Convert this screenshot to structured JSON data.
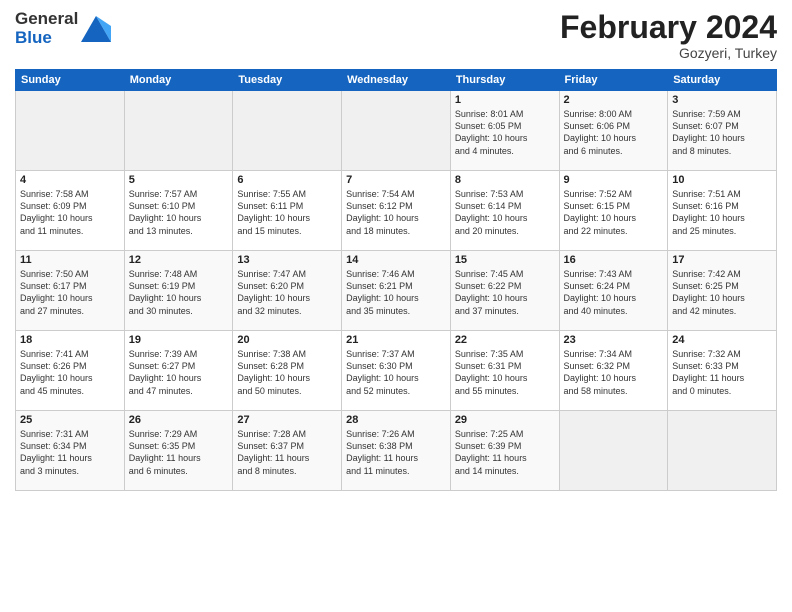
{
  "header": {
    "logo_general": "General",
    "logo_blue": "Blue",
    "title": "February 2024",
    "subtitle": "Gozyeri, Turkey"
  },
  "weekdays": [
    "Sunday",
    "Monday",
    "Tuesday",
    "Wednesday",
    "Thursday",
    "Friday",
    "Saturday"
  ],
  "weeks": [
    [
      {
        "day": "",
        "info": ""
      },
      {
        "day": "",
        "info": ""
      },
      {
        "day": "",
        "info": ""
      },
      {
        "day": "",
        "info": ""
      },
      {
        "day": "1",
        "info": "Sunrise: 8:01 AM\nSunset: 6:05 PM\nDaylight: 10 hours\nand 4 minutes."
      },
      {
        "day": "2",
        "info": "Sunrise: 8:00 AM\nSunset: 6:06 PM\nDaylight: 10 hours\nand 6 minutes."
      },
      {
        "day": "3",
        "info": "Sunrise: 7:59 AM\nSunset: 6:07 PM\nDaylight: 10 hours\nand 8 minutes."
      }
    ],
    [
      {
        "day": "4",
        "info": "Sunrise: 7:58 AM\nSunset: 6:09 PM\nDaylight: 10 hours\nand 11 minutes."
      },
      {
        "day": "5",
        "info": "Sunrise: 7:57 AM\nSunset: 6:10 PM\nDaylight: 10 hours\nand 13 minutes."
      },
      {
        "day": "6",
        "info": "Sunrise: 7:55 AM\nSunset: 6:11 PM\nDaylight: 10 hours\nand 15 minutes."
      },
      {
        "day": "7",
        "info": "Sunrise: 7:54 AM\nSunset: 6:12 PM\nDaylight: 10 hours\nand 18 minutes."
      },
      {
        "day": "8",
        "info": "Sunrise: 7:53 AM\nSunset: 6:14 PM\nDaylight: 10 hours\nand 20 minutes."
      },
      {
        "day": "9",
        "info": "Sunrise: 7:52 AM\nSunset: 6:15 PM\nDaylight: 10 hours\nand 22 minutes."
      },
      {
        "day": "10",
        "info": "Sunrise: 7:51 AM\nSunset: 6:16 PM\nDaylight: 10 hours\nand 25 minutes."
      }
    ],
    [
      {
        "day": "11",
        "info": "Sunrise: 7:50 AM\nSunset: 6:17 PM\nDaylight: 10 hours\nand 27 minutes."
      },
      {
        "day": "12",
        "info": "Sunrise: 7:48 AM\nSunset: 6:19 PM\nDaylight: 10 hours\nand 30 minutes."
      },
      {
        "day": "13",
        "info": "Sunrise: 7:47 AM\nSunset: 6:20 PM\nDaylight: 10 hours\nand 32 minutes."
      },
      {
        "day": "14",
        "info": "Sunrise: 7:46 AM\nSunset: 6:21 PM\nDaylight: 10 hours\nand 35 minutes."
      },
      {
        "day": "15",
        "info": "Sunrise: 7:45 AM\nSunset: 6:22 PM\nDaylight: 10 hours\nand 37 minutes."
      },
      {
        "day": "16",
        "info": "Sunrise: 7:43 AM\nSunset: 6:24 PM\nDaylight: 10 hours\nand 40 minutes."
      },
      {
        "day": "17",
        "info": "Sunrise: 7:42 AM\nSunset: 6:25 PM\nDaylight: 10 hours\nand 42 minutes."
      }
    ],
    [
      {
        "day": "18",
        "info": "Sunrise: 7:41 AM\nSunset: 6:26 PM\nDaylight: 10 hours\nand 45 minutes."
      },
      {
        "day": "19",
        "info": "Sunrise: 7:39 AM\nSunset: 6:27 PM\nDaylight: 10 hours\nand 47 minutes."
      },
      {
        "day": "20",
        "info": "Sunrise: 7:38 AM\nSunset: 6:28 PM\nDaylight: 10 hours\nand 50 minutes."
      },
      {
        "day": "21",
        "info": "Sunrise: 7:37 AM\nSunset: 6:30 PM\nDaylight: 10 hours\nand 52 minutes."
      },
      {
        "day": "22",
        "info": "Sunrise: 7:35 AM\nSunset: 6:31 PM\nDaylight: 10 hours\nand 55 minutes."
      },
      {
        "day": "23",
        "info": "Sunrise: 7:34 AM\nSunset: 6:32 PM\nDaylight: 10 hours\nand 58 minutes."
      },
      {
        "day": "24",
        "info": "Sunrise: 7:32 AM\nSunset: 6:33 PM\nDaylight: 11 hours\nand 0 minutes."
      }
    ],
    [
      {
        "day": "25",
        "info": "Sunrise: 7:31 AM\nSunset: 6:34 PM\nDaylight: 11 hours\nand 3 minutes."
      },
      {
        "day": "26",
        "info": "Sunrise: 7:29 AM\nSunset: 6:35 PM\nDaylight: 11 hours\nand 6 minutes."
      },
      {
        "day": "27",
        "info": "Sunrise: 7:28 AM\nSunset: 6:37 PM\nDaylight: 11 hours\nand 8 minutes."
      },
      {
        "day": "28",
        "info": "Sunrise: 7:26 AM\nSunset: 6:38 PM\nDaylight: 11 hours\nand 11 minutes."
      },
      {
        "day": "29",
        "info": "Sunrise: 7:25 AM\nSunset: 6:39 PM\nDaylight: 11 hours\nand 14 minutes."
      },
      {
        "day": "",
        "info": ""
      },
      {
        "day": "",
        "info": ""
      }
    ]
  ]
}
